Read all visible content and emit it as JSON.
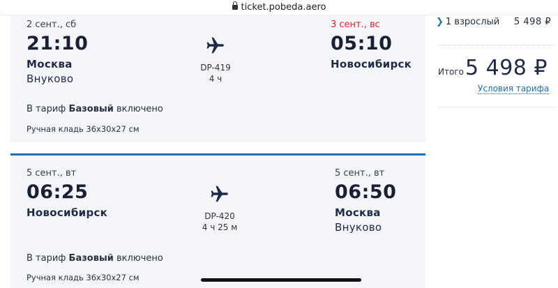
{
  "browser": {
    "url": "ticket.pobeda.aero"
  },
  "flights": [
    {
      "dep_date": "2 сент., сб",
      "dep_time": "21:10",
      "dep_city": "Москва",
      "dep_airport": "Внуково",
      "flight_no": "DP-419",
      "duration": "4 ч",
      "arr_date": "3 сент., вс",
      "arr_time": "05:10",
      "arr_city": "Новосибирск",
      "arr_airport": "",
      "tariff_prefix": "В тариф",
      "tariff_name": "Базовый",
      "tariff_suffix": "включено",
      "baggage": "Ручная кладь 36x30x27 см"
    },
    {
      "dep_date": "5 сент., вт",
      "dep_time": "06:25",
      "dep_city": "Новосибирск",
      "dep_airport": "",
      "flight_no": "DP-420",
      "duration": "4 ч 25 м",
      "arr_date": "5 сент., вт",
      "arr_time": "06:50",
      "arr_city": "Москва",
      "arr_airport": "Внуково",
      "tariff_prefix": "В тариф",
      "tariff_name": "Базовый",
      "tariff_suffix": "включено",
      "baggage": "Ручная кладь 36x30x27 см"
    }
  ],
  "summary": {
    "passengers_label": "1 взрослый",
    "passengers_price": "5 498 ₽",
    "total_label": "Итого",
    "total_value": "5 498 ₽",
    "tariff_link": "Условия тарифа"
  },
  "icons": {
    "lock": "lock-icon",
    "plane": "plane-icon",
    "chevron": "chevron-right-icon"
  },
  "colors": {
    "accent": "#1c6fb2",
    "alert_date": "#d0282e",
    "card_bg": "#f4f5f8"
  }
}
